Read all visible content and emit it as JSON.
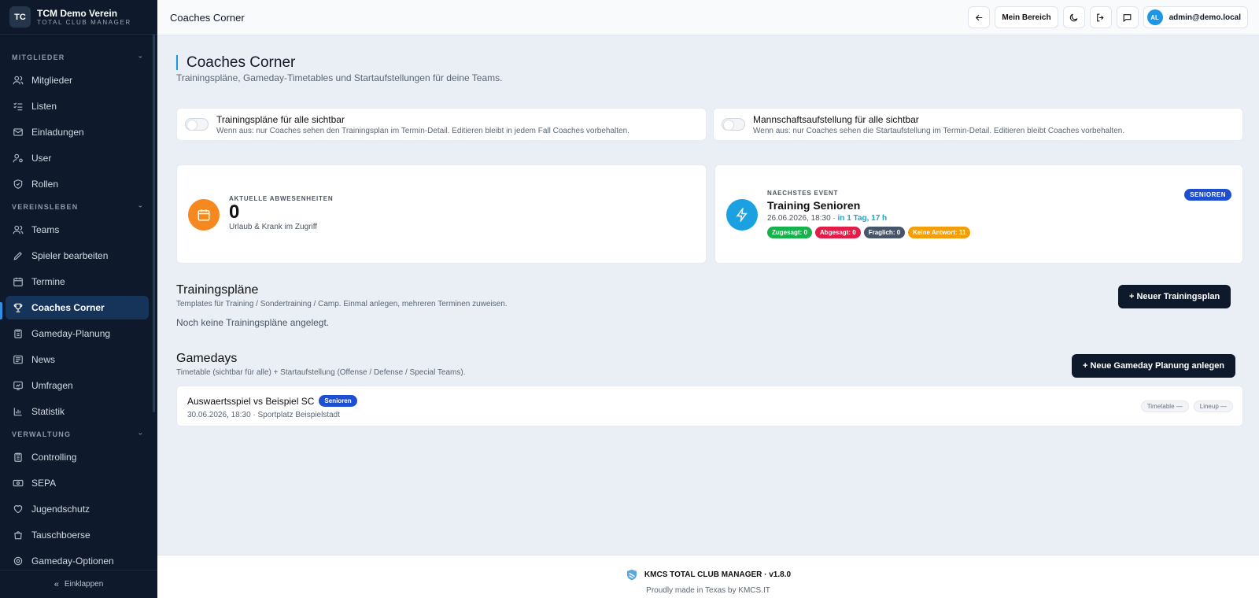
{
  "brand": {
    "logo": "TC",
    "name": "TCM Demo Verein",
    "subtitle": "TOTAL CLUB MANAGER"
  },
  "sidebar": {
    "sections": [
      {
        "label": "MITGLIEDER",
        "items": [
          {
            "label": "Mitglieder",
            "icon": "users-icon"
          },
          {
            "label": "Listen",
            "icon": "list-icon"
          },
          {
            "label": "Einladungen",
            "icon": "mail-icon"
          },
          {
            "label": "User",
            "icon": "user-key-icon"
          },
          {
            "label": "Rollen",
            "icon": "shield-icon"
          }
        ]
      },
      {
        "label": "VEREINSLEBEN",
        "items": [
          {
            "label": "Teams",
            "icon": "users-icon"
          },
          {
            "label": "Spieler bearbeiten",
            "icon": "pencil-icon"
          },
          {
            "label": "Termine",
            "icon": "calendar-icon"
          },
          {
            "label": "Coaches Corner",
            "icon": "trophy-icon",
            "active": true
          },
          {
            "label": "Gameday-Planung",
            "icon": "clipboard-icon"
          },
          {
            "label": "News",
            "icon": "newspaper-icon"
          },
          {
            "label": "Umfragen",
            "icon": "poll-icon"
          },
          {
            "label": "Statistik",
            "icon": "chart-icon"
          }
        ]
      },
      {
        "label": "VERWALTUNG",
        "items": [
          {
            "label": "Controlling",
            "icon": "clipboard-icon"
          },
          {
            "label": "SEPA",
            "icon": "banknote-icon"
          },
          {
            "label": "Jugendschutz",
            "icon": "heart-icon"
          },
          {
            "label": "Tauschboerse",
            "icon": "bag-icon"
          },
          {
            "label": "Gameday-Optionen",
            "icon": "settings-icon"
          }
        ]
      }
    ],
    "collapse_label": "Einklappen"
  },
  "topbar": {
    "title": "Coaches Corner",
    "my_area_label": "Mein Bereich",
    "avatar_initials": "AL",
    "user_email": "admin@demo.local"
  },
  "page": {
    "title": "Coaches Corner",
    "subtitle": "Trainingspläne, Gameday-Timetables und Startaufstellungen für deine Teams."
  },
  "toggles": [
    {
      "title": "Trainingspläne für alle sichtbar",
      "desc": "Wenn aus: nur Coaches sehen den Trainingsplan im Termin-Detail. Editieren bleibt in jedem Fall Coaches vorbehalten.",
      "on": false
    },
    {
      "title": "Mannschaftsaufstellung für alle sichtbar",
      "desc": "Wenn aus: nur Coaches sehen die Startaufstellung im Termin-Detail. Editieren bleibt Coaches vorbehalten.",
      "on": false
    }
  ],
  "absences": {
    "label": "AKTUELLE ABWESENHEITEN",
    "value": "0",
    "desc": "Urlaub & Krank im Zugriff",
    "color": "#f5881f"
  },
  "next_event": {
    "label": "NAECHSTES EVENT",
    "title": "Training Senioren",
    "datetime": "26.06.2026, 18:30 ·",
    "relative": "in 1 Tag, 17 h",
    "badge": "SENIOREN",
    "color": "#1ba0e2",
    "pills": [
      {
        "label": "Zugesagt: 0",
        "color": "#16b24b"
      },
      {
        "label": "Abgesagt: 0",
        "color": "#e11d48"
      },
      {
        "label": "Fraglich: 0",
        "color": "#475569"
      },
      {
        "label": "Keine Antwort: 11",
        "color": "#f59e0b"
      }
    ]
  },
  "training_plans": {
    "title": "Trainingspläne",
    "desc": "Templates für Training / Sondertraining / Camp. Einmal anlegen, mehreren Terminen zuweisen.",
    "empty": "Noch keine Trainingspläne angelegt.",
    "new_button": "+ Neuer Trainingsplan"
  },
  "gamedays": {
    "title": "Gamedays",
    "desc": "Timetable (sichtbar für alle) + Startaufstellung (Offense / Defense / Special Teams).",
    "new_button": "+ Neue Gameday Planung anlegen",
    "items": [
      {
        "title": "Auswaertsspiel vs Beispiel SC",
        "badge": "Senioren",
        "meta": "30.06.2026, 18:30 · Sportplatz Beispielstadt",
        "timetable": "Timetable —",
        "lineup": "Lineup —"
      }
    ]
  },
  "footer": {
    "product": "KMCS TOTAL CLUB MANAGER · v1.8.0",
    "credit": "Proudly made in Texas by KMCS.IT"
  }
}
